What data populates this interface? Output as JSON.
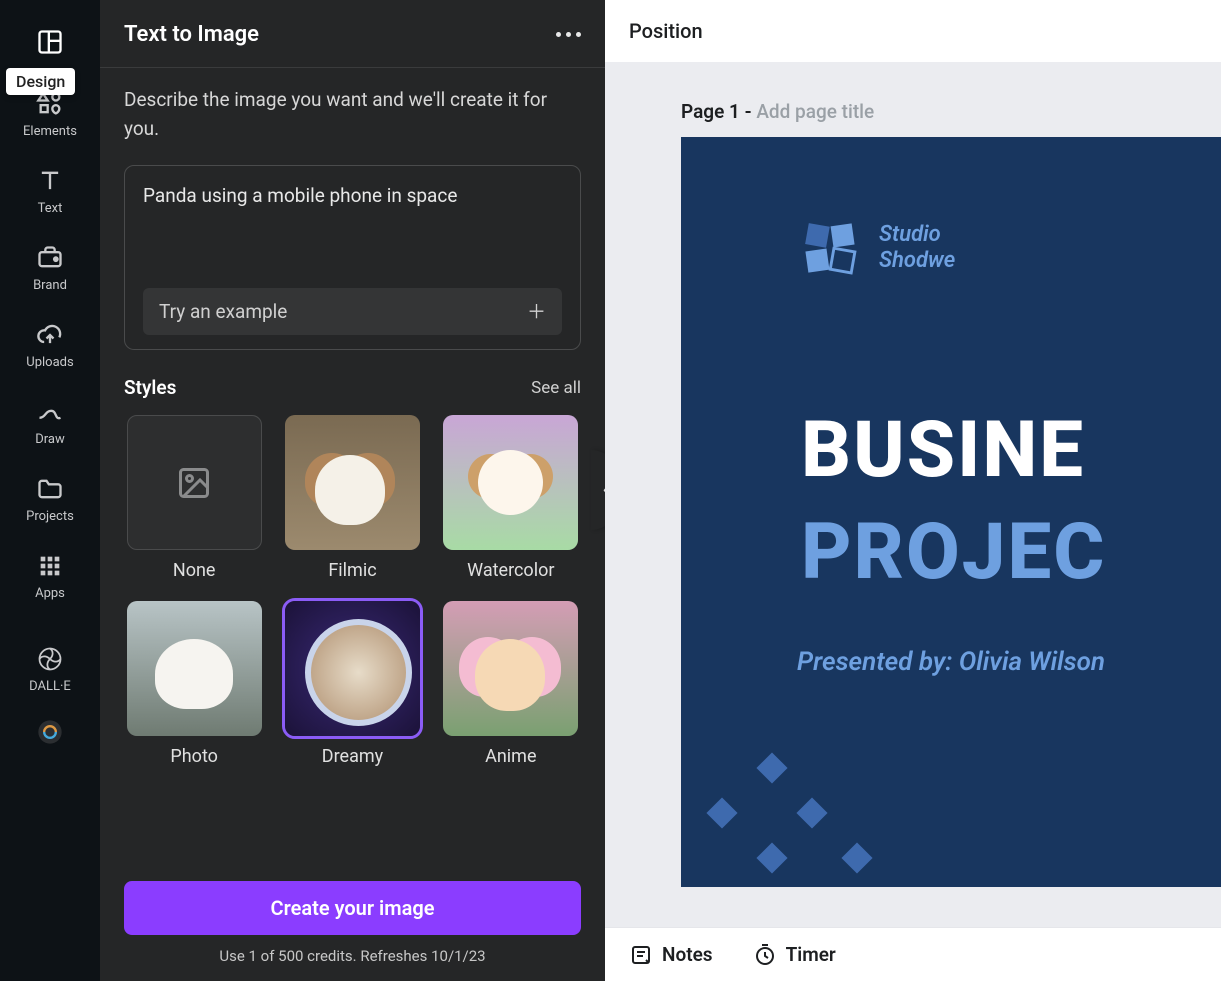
{
  "nav": {
    "tooltip": "Design",
    "items": [
      {
        "id": "design",
        "label": ""
      },
      {
        "id": "elements",
        "label": "Elements"
      },
      {
        "id": "text",
        "label": "Text"
      },
      {
        "id": "brand",
        "label": "Brand"
      },
      {
        "id": "uploads",
        "label": "Uploads"
      },
      {
        "id": "draw",
        "label": "Draw"
      },
      {
        "id": "projects",
        "label": "Projects"
      },
      {
        "id": "apps",
        "label": "Apps"
      },
      {
        "id": "dalle",
        "label": "DALL·E"
      }
    ]
  },
  "panel": {
    "title": "Text to Image",
    "intro": "Describe the image you want and we'll create it for you.",
    "prompt_value": "Panda using a mobile phone in space",
    "try_example_label": "Try an example",
    "styles_heading": "Styles",
    "see_all": "See all",
    "styles": [
      {
        "id": "none",
        "label": "None",
        "selected": false
      },
      {
        "id": "filmic",
        "label": "Filmic",
        "selected": false
      },
      {
        "id": "watercolor",
        "label": "Watercolor",
        "selected": false
      },
      {
        "id": "photo",
        "label": "Photo",
        "selected": false
      },
      {
        "id": "dreamy",
        "label": "Dreamy",
        "selected": true
      },
      {
        "id": "anime",
        "label": "Anime",
        "selected": false
      }
    ],
    "create_button": "Create your image",
    "credits_text": "Use 1 of 500 credits. Refreshes 10/1/23"
  },
  "canvas": {
    "position_label": "Position",
    "page_prefix": "Page 1 - ",
    "page_title_placeholder": "Add page title",
    "design": {
      "brand_line1": "Studio",
      "brand_line2": "Shodwe",
      "headline1": "BUSINE",
      "headline2": "PROJEC",
      "presenter": "Presented by: Olivia Wilson"
    }
  },
  "bottombar": {
    "notes": "Notes",
    "timer": "Timer"
  }
}
